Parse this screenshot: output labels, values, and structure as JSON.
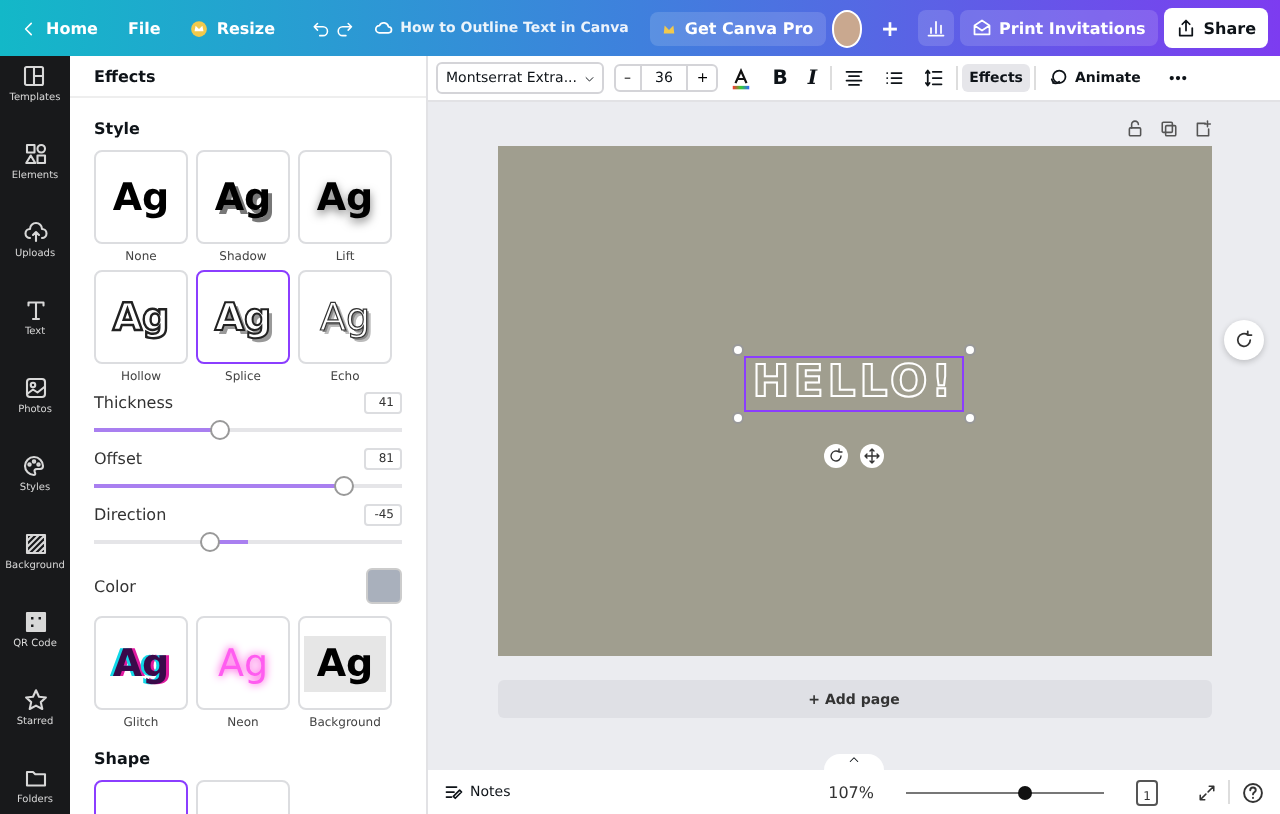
{
  "top_bar": {
    "home": "Home",
    "file": "File",
    "resize": "Resize",
    "title": "How to Outline Text in Canva",
    "pro": "Get Canva Pro",
    "add": "+",
    "print": "Print Invitations",
    "share": "Share"
  },
  "sidebar": {
    "items": [
      {
        "label": "Templates"
      },
      {
        "label": "Elements"
      },
      {
        "label": "Uploads"
      },
      {
        "label": "Text"
      },
      {
        "label": "Photos"
      },
      {
        "label": "Styles"
      },
      {
        "label": "Background"
      },
      {
        "label": "QR Code"
      },
      {
        "label": "Starred"
      },
      {
        "label": "Folders"
      }
    ]
  },
  "panel": {
    "title": "Effects",
    "style_heading": "Style",
    "styles": [
      {
        "label": "None",
        "kind": "none",
        "sample": "Ag",
        "selected": false
      },
      {
        "label": "Shadow",
        "kind": "shadow",
        "sample": "Ag",
        "selected": false
      },
      {
        "label": "Lift",
        "kind": "lift",
        "sample": "Ag",
        "selected": false
      },
      {
        "label": "Hollow",
        "kind": "hollow",
        "sample": "Ag",
        "selected": false
      },
      {
        "label": "Splice",
        "kind": "splice",
        "sample": "Ag",
        "selected": true
      },
      {
        "label": "Echo",
        "kind": "echo",
        "sample": "Ag",
        "selected": false
      }
    ],
    "sliders": [
      {
        "label": "Thickness",
        "value": "41",
        "kind": "range",
        "level": 0.41
      },
      {
        "label": "Offset",
        "value": "81",
        "kind": "range",
        "level": 0.81
      },
      {
        "label": "Direction",
        "value": "-45",
        "kind": "bipolar",
        "level": 0.375
      }
    ],
    "color_label": "Color",
    "color": "#a9b0bc",
    "effects": [
      {
        "label": "Glitch",
        "kind": "glitch",
        "sample": "Ag",
        "selected": false
      },
      {
        "label": "Neon",
        "kind": "neon",
        "sample": "Ag",
        "selected": false
      },
      {
        "label": "Background",
        "kind": "background",
        "sample": "Ag",
        "selected": false
      }
    ],
    "shape_heading": "Shape",
    "shapes": [
      {
        "selected": true
      },
      {
        "selected": false
      }
    ]
  },
  "toolbar": {
    "font": "Montserrat Extra...",
    "minus": "–",
    "size": "36",
    "plus": "+",
    "bold": "B",
    "italic": "I",
    "effects": {
      "label": "Effects",
      "selected": true
    },
    "animate": "Animate"
  },
  "canvas": {
    "text": "HELLO!",
    "selected": true,
    "add_page": "+ Add page"
  },
  "bottom_bar": {
    "notes": "Notes",
    "zoom": "107%",
    "zoom_slider": {
      "level": 0.6
    },
    "page_count": "1"
  }
}
